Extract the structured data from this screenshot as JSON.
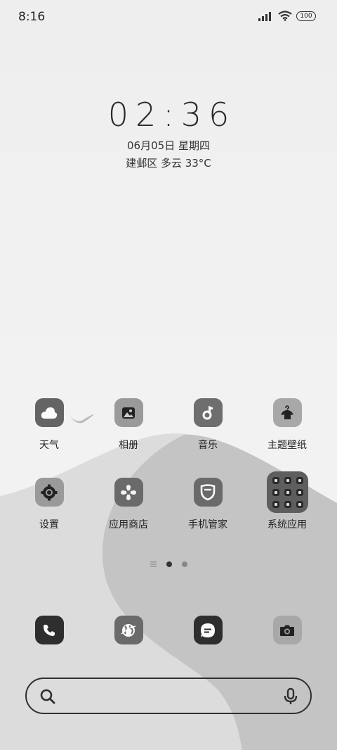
{
  "status_bar": {
    "time": "8:16",
    "battery": "100",
    "icons": [
      "signal-icon",
      "wifi-icon",
      "battery-icon"
    ]
  },
  "clock": {
    "time": "02:36",
    "date": "06月05日 星期四",
    "weather": "建邺区 多云 33°C"
  },
  "apps": [
    {
      "label": "天气",
      "icon": "cloud-icon",
      "bg": "#646464"
    },
    {
      "label": "相册",
      "icon": "photo-icon",
      "bg": "#9a9a9a"
    },
    {
      "label": "音乐",
      "icon": "music-note-icon",
      "bg": "#6e6e6e"
    },
    {
      "label": "主题壁纸",
      "icon": "tshirt-hanger-icon",
      "bg": "#a8a8a8"
    },
    {
      "label": "设置",
      "icon": "gear-icon",
      "bg": "#9a9a9a"
    },
    {
      "label": "应用商店",
      "icon": "store-swirl-icon",
      "bg": "#6a6a6a"
    },
    {
      "label": "手机管家",
      "icon": "shield-icon",
      "bg": "#6a6a6a"
    },
    {
      "label": "系统应用",
      "icon": "folder-icon",
      "bg": "#5e5e5e"
    }
  ],
  "page_indicator": {
    "pages": 2,
    "current": 1,
    "icon": "list-icon"
  },
  "dock": [
    {
      "name": "phone",
      "icon": "phone-icon",
      "bg": "#2e2e2e"
    },
    {
      "name": "browser",
      "icon": "globe-icon",
      "bg": "#6a6a6a"
    },
    {
      "name": "messages",
      "icon": "chat-bubble-icon",
      "bg": "#2e2e2e"
    },
    {
      "name": "camera",
      "icon": "camera-icon",
      "bg": "#a8a8a8"
    }
  ],
  "search": {
    "placeholder": ""
  }
}
